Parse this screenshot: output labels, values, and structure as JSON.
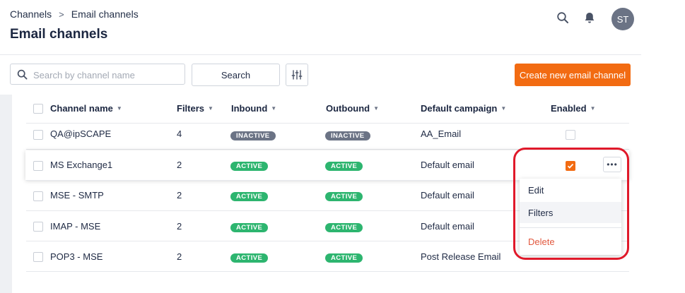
{
  "breadcrumb": {
    "root": "Channels",
    "separator": ">",
    "current": "Email channels"
  },
  "page_title": "Email channels",
  "header": {
    "avatar_initials": "ST",
    "icons": [
      "search-icon",
      "bell-icon"
    ]
  },
  "toolbar": {
    "search_placeholder": "Search by channel name",
    "search_value": "",
    "search_button": "Search",
    "filter_icon": "sliders-icon",
    "create_button": "Create new email channel"
  },
  "table": {
    "columns": [
      "Channel name",
      "Filters",
      "Inbound",
      "Outbound",
      "Default campaign",
      "Enabled"
    ],
    "rows": [
      {
        "name": "QA@ipSCAPE",
        "filters": "4",
        "inbound": "INACTIVE",
        "outbound": "INACTIVE",
        "campaign": "AA_Email",
        "enabled": false
      },
      {
        "name": "MS Exchange1",
        "filters": "2",
        "inbound": "ACTIVE",
        "outbound": "ACTIVE",
        "campaign": "Default email",
        "enabled": true
      },
      {
        "name": "MSE - SMTP",
        "filters": "2",
        "inbound": "ACTIVE",
        "outbound": "ACTIVE",
        "campaign": "Default email",
        "enabled": false
      },
      {
        "name": "IMAP - MSE",
        "filters": "2",
        "inbound": "ACTIVE",
        "outbound": "ACTIVE",
        "campaign": "Default email",
        "enabled": false
      },
      {
        "name": "POP3 - MSE",
        "filters": "2",
        "inbound": "ACTIVE",
        "outbound": "ACTIVE",
        "campaign": "Post Release Email",
        "enabled": false
      }
    ]
  },
  "context_menu": {
    "items": [
      {
        "label": "Edit",
        "color": "#1f2a44"
      },
      {
        "label": "Filters",
        "color": "#1f2a44"
      },
      {
        "label": "Delete",
        "color": "#e2583e"
      }
    ]
  },
  "colors": {
    "accent": "#f26b12",
    "active": "#2db56f",
    "inactive": "#6b7385",
    "highlight": "#e0192a"
  }
}
